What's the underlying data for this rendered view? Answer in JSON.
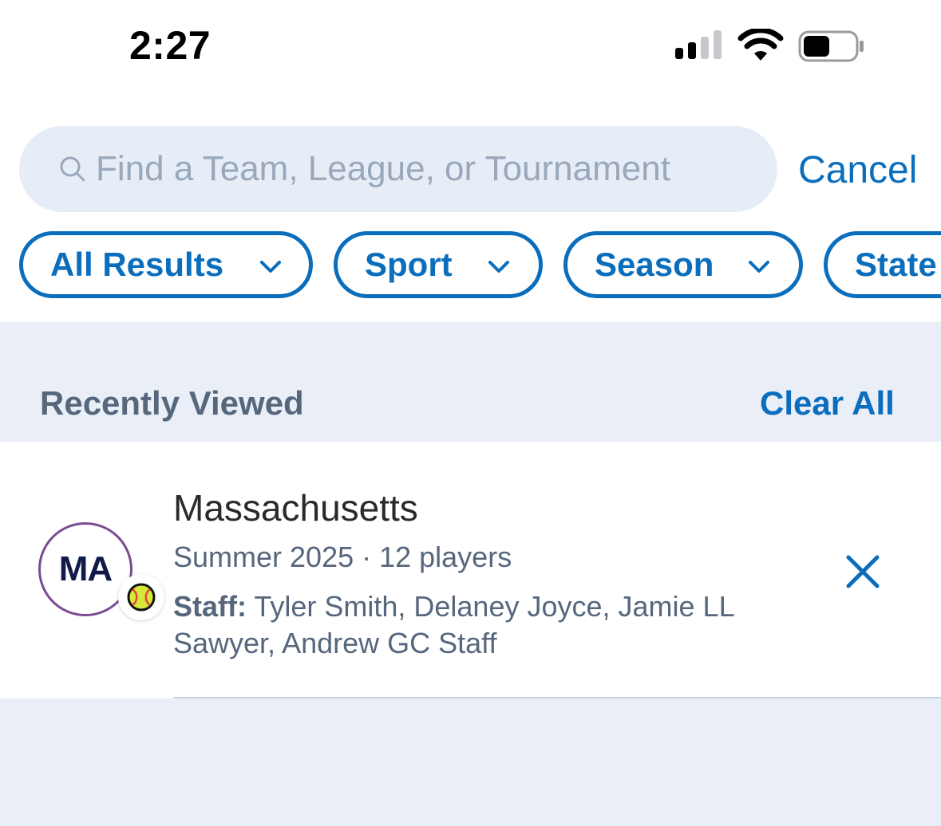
{
  "status_bar": {
    "time": "2:27"
  },
  "search": {
    "placeholder": "Find a Team, League, or Tournament",
    "value": "",
    "cancel_label": "Cancel"
  },
  "filters": [
    {
      "label": "All Results",
      "icon": "chevron-down-icon"
    },
    {
      "label": "Sport",
      "icon": "chevron-down-icon"
    },
    {
      "label": "Season",
      "icon": "chevron-down-icon"
    },
    {
      "label": "State",
      "icon": "chevron-down-icon"
    }
  ],
  "recently_viewed": {
    "title": "Recently Viewed",
    "clear_all_label": "Clear All",
    "items": [
      {
        "avatar_initials": "MA",
        "sport_icon": "softball-icon",
        "name": "Massachusetts",
        "subtitle": "Summer 2025 · 12 players",
        "staff_label": "Staff:",
        "staff_names": " Tyler Smith, Delaney Joyce, Jamie LL Sawyer, Andrew GC Staff"
      }
    ]
  },
  "colors": {
    "accent": "#0a6ebd",
    "muted_text": "#56677c",
    "section_bg": "#e9eef7",
    "avatar_ring": "#7b4a93"
  }
}
